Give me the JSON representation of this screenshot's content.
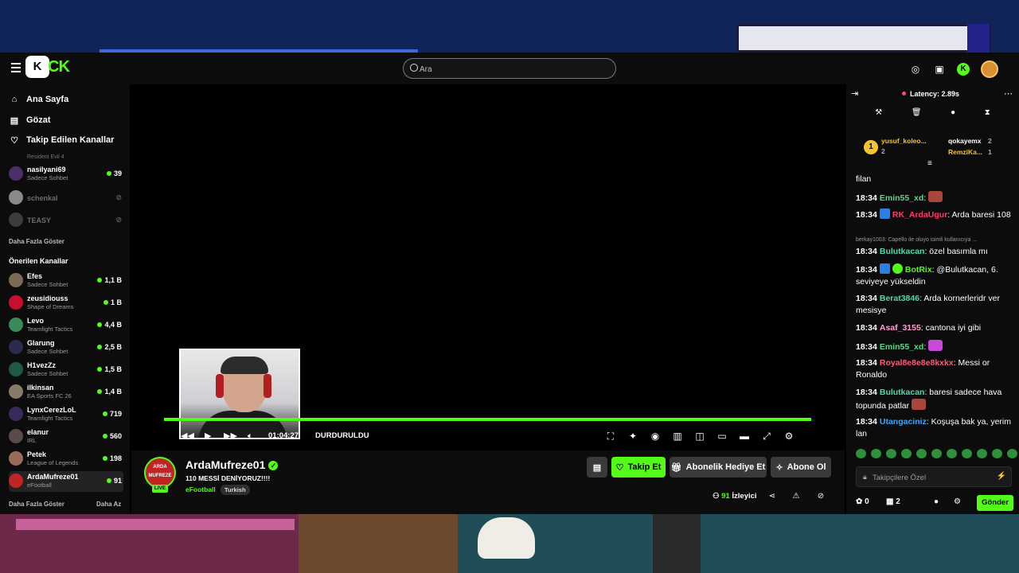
{
  "header": {
    "logo_badge": "K",
    "logo_text": "CK",
    "search_placeholder": "Ara"
  },
  "sidebar": {
    "nav": [
      {
        "label": "Ana Sayfa",
        "icon": "home-icon"
      },
      {
        "label": "Gözat",
        "icon": "browse-icon"
      },
      {
        "label": "Takip Edilen Kanallar",
        "icon": "heart-icon"
      }
    ],
    "followed_partial": "Resident Evil 4",
    "followed": [
      {
        "name": "nasilyani69",
        "sub": "Sadece Sohbet",
        "viewers": "39",
        "online": true
      },
      {
        "name": "schenkal",
        "sub": "",
        "viewers": "",
        "online": false
      },
      {
        "name": "TEASY",
        "sub": "",
        "viewers": "",
        "online": false
      }
    ],
    "show_more": "Daha Fazla Göster",
    "recommended_title": "Önerilen Kanallar",
    "recommended": [
      {
        "name": "Efes",
        "sub": "Sadece Sohbet",
        "viewers": "1,1 B"
      },
      {
        "name": "zeusidiouss",
        "sub": "Shape of Dreams",
        "viewers": "1 B"
      },
      {
        "name": "Levo",
        "sub": "Teamfight Tactics",
        "viewers": "4,4 B"
      },
      {
        "name": "Glarung",
        "sub": "Sadece Sohbet",
        "viewers": "2,5 B"
      },
      {
        "name": "H1vezZz",
        "sub": "Sadece Sohbet",
        "viewers": "1,5 B"
      },
      {
        "name": "ilkinsan",
        "sub": "EA Sports FC 26",
        "viewers": "1,4 B"
      },
      {
        "name": "LynxCerezLoL",
        "sub": "Teamfight Tactics",
        "viewers": "719"
      },
      {
        "name": "elanur",
        "sub": "IRL",
        "viewers": "560"
      },
      {
        "name": "Petek",
        "sub": "League of Legends",
        "viewers": "198"
      },
      {
        "name": "ArdaMufreze01",
        "sub": "eFootball",
        "viewers": "91"
      }
    ],
    "show_more_2": "Daha Fazla Göster",
    "show_less": "Daha Az"
  },
  "player": {
    "time": "01:04:27",
    "status": "DURDURULDU",
    "progress": 1.0
  },
  "stream": {
    "avatar_text": "ARDA MUFREZE",
    "live": "LIVE",
    "name": "ArdaMufreze01",
    "title": "110 MESSİ DENİYORUZ!!!!",
    "category": "eFootball",
    "tag": "Turkish",
    "follow": "Takip Et",
    "gift": "Abonelik Hediye Et",
    "subscribe": "Abone Ol",
    "viewers": "91",
    "viewers_label": "İzleyici"
  },
  "chat": {
    "latency": "Latency: 2.89s",
    "top_users": [
      {
        "name": "yusuf_koleo...",
        "count": "2"
      },
      {
        "name": "qokayemx",
        "count": "2"
      },
      {
        "name": "RemziKa...",
        "count": "1"
      }
    ],
    "messages": [
      {
        "time": "",
        "user": "",
        "color": "#ffffff",
        "text": "filan"
      },
      {
        "time": "18:34",
        "user": "Emin55_xd",
        "color": "#59d88a",
        "text": ": "
      },
      {
        "time": "18:34",
        "user": "RK_ArdaUgur",
        "color": "#ff3b6b",
        "text": ": Arda baresi 108"
      },
      {
        "time": "18:34",
        "user": "Bulutkacan",
        "color": "#53d7b0",
        "text": ": özel basımla mı"
      },
      {
        "time": "18:34",
        "user": "BotRix",
        "color": "#53fc18",
        "text": ": @Bulutkacan, 6. seviyeye yükseldin"
      },
      {
        "time": "18:34",
        "user": "Berat3846",
        "color": "#53d7b0",
        "text": ": Arda kornerleridr ver mesisye"
      },
      {
        "time": "18:34",
        "user": "Asaf_3155",
        "color": "#ff9fd0",
        "text": ": cantona iyi gibi"
      },
      {
        "time": "18:34",
        "user": "Emin55_xd",
        "color": "#59d88a",
        "text": ": "
      },
      {
        "time": "18:34",
        "user": "Royal8e8e8e8kxkx",
        "color": "#ff5a7a",
        "text": ": Messi or Ronaldo"
      },
      {
        "time": "18:34",
        "user": "Bulutkacan",
        "color": "#53d7b0",
        "text": ": baresi sadece hava topunda patlar"
      },
      {
        "time": "18:34",
        "user": "Utangaciniz",
        "color": "#3aa6ff",
        "text": ": Koşuşa bak ya, yerim lan"
      }
    ],
    "reply_preview": "berkay1003: Capello ile oluyo isimli kullanıcıya ...",
    "input_placeholder": "Takipçilere Özel",
    "points": "0",
    "gifts": "2",
    "send": "Gönder"
  }
}
